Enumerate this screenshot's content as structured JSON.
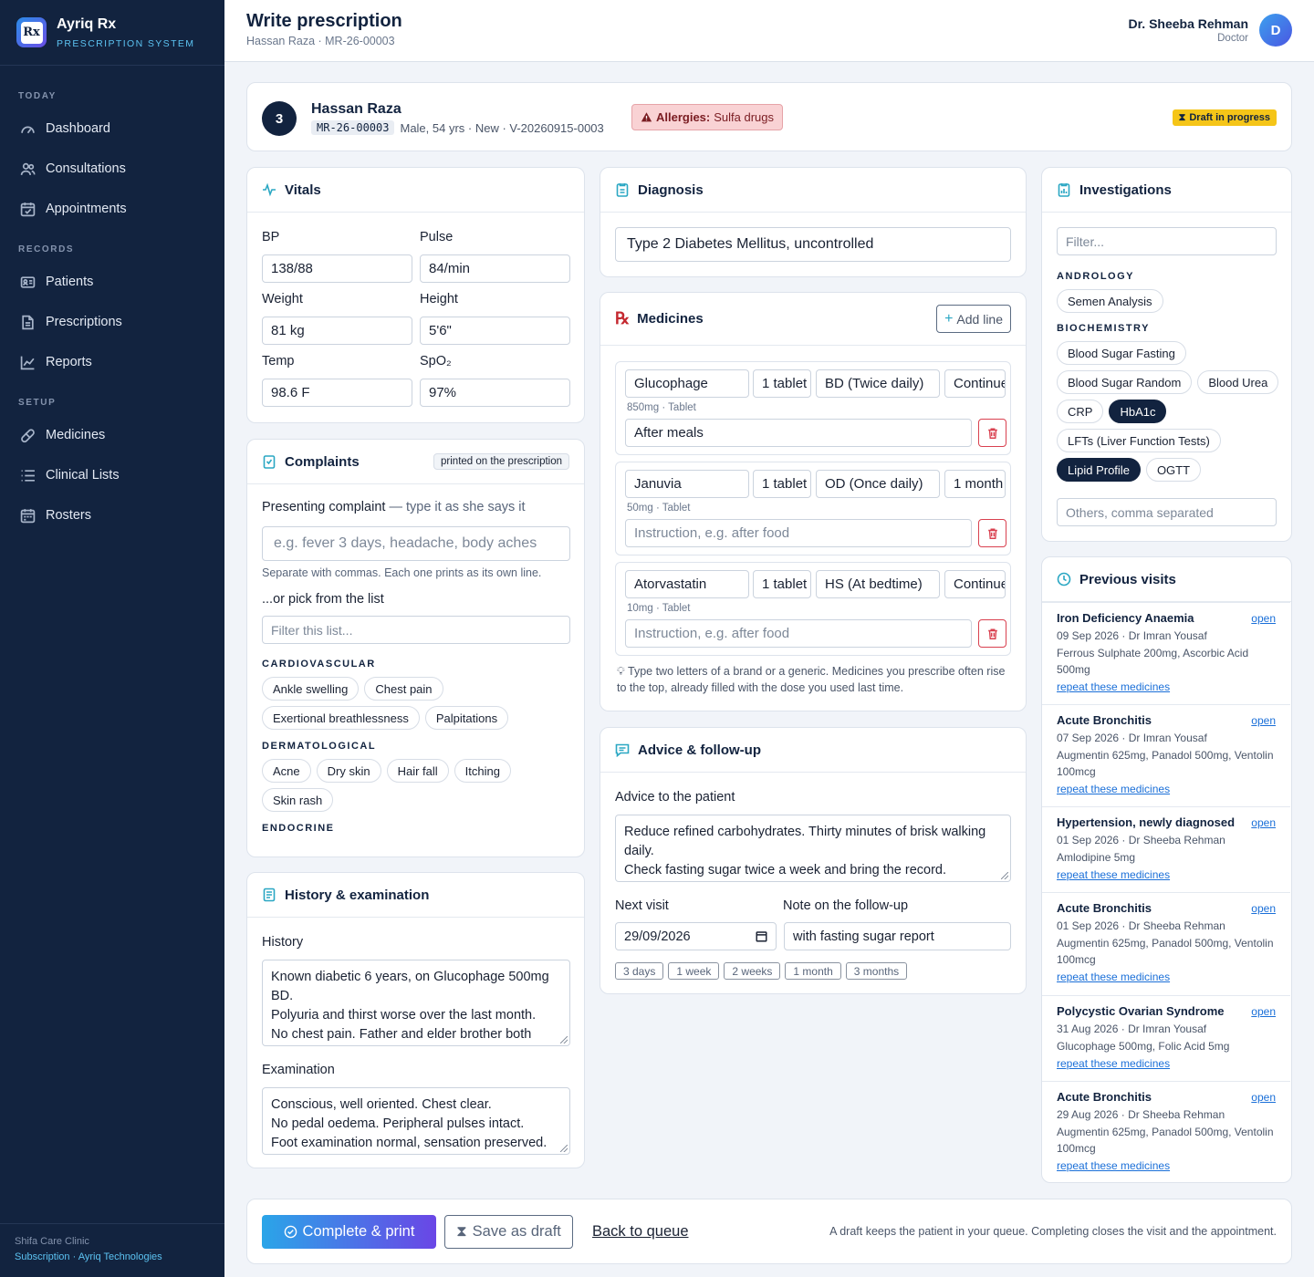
{
  "sidebar": {
    "brand": {
      "name": "Ayriq Rx",
      "sub": "PRESCRIPTION SYSTEM",
      "logo_glyph": "Rx"
    },
    "sections": [
      {
        "title": "TODAY",
        "items": [
          {
            "label": "Dashboard",
            "icon": "gauge-icon"
          },
          {
            "label": "Consultations",
            "icon": "users-icon"
          },
          {
            "label": "Appointments",
            "icon": "calendar-check-icon"
          }
        ]
      },
      {
        "title": "RECORDS",
        "items": [
          {
            "label": "Patients",
            "icon": "id-card-icon"
          },
          {
            "label": "Prescriptions",
            "icon": "file-icon"
          },
          {
            "label": "Reports",
            "icon": "chart-line-icon"
          }
        ]
      },
      {
        "title": "SETUP",
        "items": [
          {
            "label": "Medicines",
            "icon": "pill-icon"
          },
          {
            "label": "Clinical Lists",
            "icon": "list-icon"
          },
          {
            "label": "Rosters",
            "icon": "calendar-icon"
          }
        ]
      }
    ],
    "footer": {
      "clinic": "Shifa Care Clinic",
      "subscription": "Subscription",
      "sep": "·",
      "company": "Ayriq Technologies"
    }
  },
  "topbar": {
    "title": "Write prescription",
    "subtitle": "Hassan Raza · MR-26-00003",
    "user_name": "Dr. Sheeba Rehman",
    "user_role": "Doctor",
    "avatar": "D"
  },
  "patient": {
    "token": "3",
    "name": "Hassan Raza",
    "mr": "MR-26-00003",
    "details": "Male, 54 yrs · New · V-20260915-0003",
    "allergy_label": "Allergies:",
    "allergy_value": "Sulfa drugs",
    "status": "Draft in progress"
  },
  "vitals": {
    "title": "Vitals",
    "fields": [
      {
        "label": "BP",
        "value": "138/88"
      },
      {
        "label": "Pulse",
        "value": "84/min"
      },
      {
        "label": "Weight",
        "value": "81 kg"
      },
      {
        "label": "Height",
        "value": "5'6\""
      },
      {
        "label": "Temp",
        "value": "98.6 F"
      },
      {
        "label": "SpO₂",
        "value": "97%"
      }
    ]
  },
  "complaints": {
    "title": "Complaints",
    "badge": "printed on the prescription",
    "presenting_label": "Presenting complaint",
    "presenting_hint": "— type it as she says it",
    "placeholder": "e.g. fever 3 days, headache, body aches",
    "help": "Separate with commas. Each one prints as its own line.",
    "pick_label": "...or pick from the list",
    "filter_placeholder": "Filter this list...",
    "groups": [
      {
        "name": "CARDIOVASCULAR",
        "items": [
          "Ankle swelling",
          "Chest pain",
          "Exertional breathlessness",
          "Palpitations"
        ]
      },
      {
        "name": "DERMATOLOGICAL",
        "items": [
          "Acne",
          "Dry skin",
          "Hair fall",
          "Itching",
          "Skin rash"
        ]
      },
      {
        "name": "ENDOCRINE",
        "items": []
      }
    ]
  },
  "history": {
    "title": "History & examination",
    "history_label": "History",
    "history_text": "Known diabetic 6 years, on Glucophage 500mg BD.\nPolyuria and thirst worse over the last month.\nNo chest pain. Father and elder brother both",
    "exam_label": "Examination",
    "exam_text": "Conscious, well oriented. Chest clear.\nNo pedal oedema. Peripheral pulses intact.\nFoot examination normal, sensation preserved."
  },
  "diagnosis": {
    "title": "Diagnosis",
    "value": "Type 2 Diabetes Mellitus, uncontrolled"
  },
  "medicines": {
    "title": "Medicines",
    "add_label": "Add line",
    "instruction_placeholder": "Instruction, e.g. after food",
    "lines": [
      {
        "name": "Glucophage",
        "dose": "1 tablet",
        "freq": "BD (Twice daily)",
        "duration": "Continue",
        "meta": "850mg · Tablet",
        "instruction": "After meals"
      },
      {
        "name": "Januvia",
        "dose": "1 tablet",
        "freq": "OD (Once daily)",
        "duration": "1 month",
        "meta": "50mg · Tablet",
        "instruction": ""
      },
      {
        "name": "Atorvastatin",
        "dose": "1 tablet",
        "freq": "HS (At bedtime)",
        "duration": "Continue",
        "meta": "10mg · Tablet",
        "instruction": ""
      }
    ],
    "tip": "Type two letters of a brand or a generic. Medicines you prescribe often rise to the top, already filled with the dose you used last time."
  },
  "advice": {
    "title": "Advice & follow-up",
    "advice_label": "Advice to the patient",
    "advice_text": "Reduce refined carbohydrates. Thirty minutes of brisk walking daily.\nCheck fasting sugar twice a week and bring the record.",
    "next_label": "Next visit",
    "next_value": "29/09/2026",
    "note_label": "Note on the follow-up",
    "note_value": "with fasting sugar report",
    "quick": [
      "3 days",
      "1 week",
      "2 weeks",
      "1 month",
      "3 months"
    ]
  },
  "investigations": {
    "title": "Investigations",
    "filter_placeholder": "Filter...",
    "groups": [
      {
        "name": "ANDROLOGY",
        "items": [
          {
            "label": "Semen Analysis",
            "selected": false
          }
        ]
      },
      {
        "name": "BIOCHEMISTRY",
        "items": [
          {
            "label": "Blood Sugar Fasting",
            "selected": false
          },
          {
            "label": "Blood Sugar Random",
            "selected": false
          },
          {
            "label": "Blood Urea",
            "selected": false
          },
          {
            "label": "CRP",
            "selected": false
          },
          {
            "label": "HbA1c",
            "selected": true
          },
          {
            "label": "LFTs (Liver Function Tests)",
            "selected": false
          },
          {
            "label": "Lipid Profile",
            "selected": true
          },
          {
            "label": "OGTT",
            "selected": false
          }
        ]
      }
    ],
    "others_placeholder": "Others, comma separated"
  },
  "previous": {
    "title": "Previous visits",
    "open_label": "open",
    "repeat_label": "repeat these medicines",
    "visits": [
      {
        "title": "Iron Deficiency Anaemia",
        "meta": "09 Sep 2026 · Dr Imran Yousaf",
        "meds": "Ferrous Sulphate 200mg, Ascorbic Acid 500mg"
      },
      {
        "title": "Acute Bronchitis",
        "meta": "07 Sep 2026 · Dr Imran Yousaf",
        "meds": "Augmentin 625mg, Panadol 500mg, Ventolin 100mcg"
      },
      {
        "title": "Hypertension, newly diagnosed",
        "meta": "01 Sep 2026 · Dr Sheeba Rehman",
        "meds": "Amlodipine 5mg"
      },
      {
        "title": "Acute Bronchitis",
        "meta": "01 Sep 2026 · Dr Sheeba Rehman",
        "meds": "Augmentin 625mg, Panadol 500mg, Ventolin 100mcg"
      },
      {
        "title": "Polycystic Ovarian Syndrome",
        "meta": "31 Aug 2026 · Dr Imran Yousaf",
        "meds": "Glucophage 500mg, Folic Acid 5mg"
      },
      {
        "title": "Acute Bronchitis",
        "meta": "29 Aug 2026 · Dr Sheeba Rehman",
        "meds": "Augmentin 625mg, Panadol 500mg, Ventolin 100mcg"
      }
    ]
  },
  "footer": {
    "complete": "Complete & print",
    "draft": "Save as draft",
    "back": "Back to queue",
    "note": "A draft keeps the patient in your queue. Completing closes the visit and the appointment."
  },
  "colors": {
    "sidebar": "#12233f",
    "accent": "#2aa7c3",
    "danger": "#d9404f",
    "status": "#f5c518",
    "link": "#1a6fd8",
    "primary_gradient": [
      "#2aa5e8",
      "#6a46e6"
    ]
  }
}
